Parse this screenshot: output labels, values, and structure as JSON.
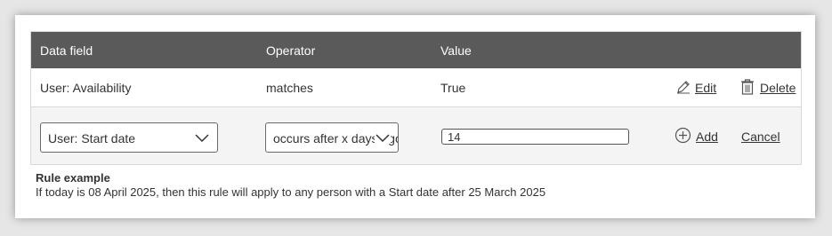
{
  "table": {
    "headers": {
      "data_field": "Data field",
      "operator": "Operator",
      "value": "Value"
    },
    "existing_rule": {
      "data_field": "User: Availability",
      "operator": "matches",
      "value": "True",
      "edit_label": "Edit",
      "delete_label": "Delete",
      "edit_icon": "pencil-icon",
      "delete_icon": "trash-icon"
    },
    "new_rule": {
      "data_field_selected": "User: Start date",
      "operator_selected": "occurs after x days ago",
      "value_input": "14",
      "add_label": "Add",
      "cancel_label": "Cancel",
      "add_icon": "plus-circle-icon"
    }
  },
  "rule_example": {
    "title": "Rule example",
    "text": "If today is 08 April 2025, then this rule will apply to any person with a Start date after 25 March 2025"
  },
  "colors": {
    "header_bg": "#5a5a5a",
    "row_alt_bg": "#f4f4f4",
    "page_bg": "#e6e6e6"
  }
}
